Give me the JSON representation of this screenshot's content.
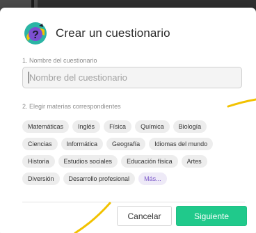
{
  "dialog": {
    "title": "Crear un cuestionario",
    "name_section_label": "1. Nombre del cuestionario",
    "name_input": {
      "value": "",
      "placeholder": "Nombre del cuestionario"
    },
    "subjects_section_label": "2. Elegir materias correspondientes",
    "subjects": [
      [
        "Matemáticas",
        "Inglés",
        "Física",
        "Química",
        "Biología"
      ],
      [
        "Ciencias",
        "Informática",
        "Geografía",
        "Idiomas del mundo"
      ],
      [
        "Historia",
        "Estudios sociales",
        "Educación física",
        "Artes"
      ],
      [
        "Diversión",
        "Desarrollo profesional"
      ]
    ],
    "more_label": "Más...",
    "cancel_label": "Cancelar",
    "next_label": "Siguiente"
  },
  "icons": {
    "logo": "quiz-question-logo-icon"
  },
  "colors": {
    "primary_button": "#20c98b",
    "more_chip_text": "#7a57c9",
    "more_chip_bg": "#eeeaf7",
    "accent_stroke": "#f2c200",
    "logo_purple": "#7c4fd1",
    "logo_yellow": "#f5c400",
    "logo_teal": "#2bb5a5"
  }
}
